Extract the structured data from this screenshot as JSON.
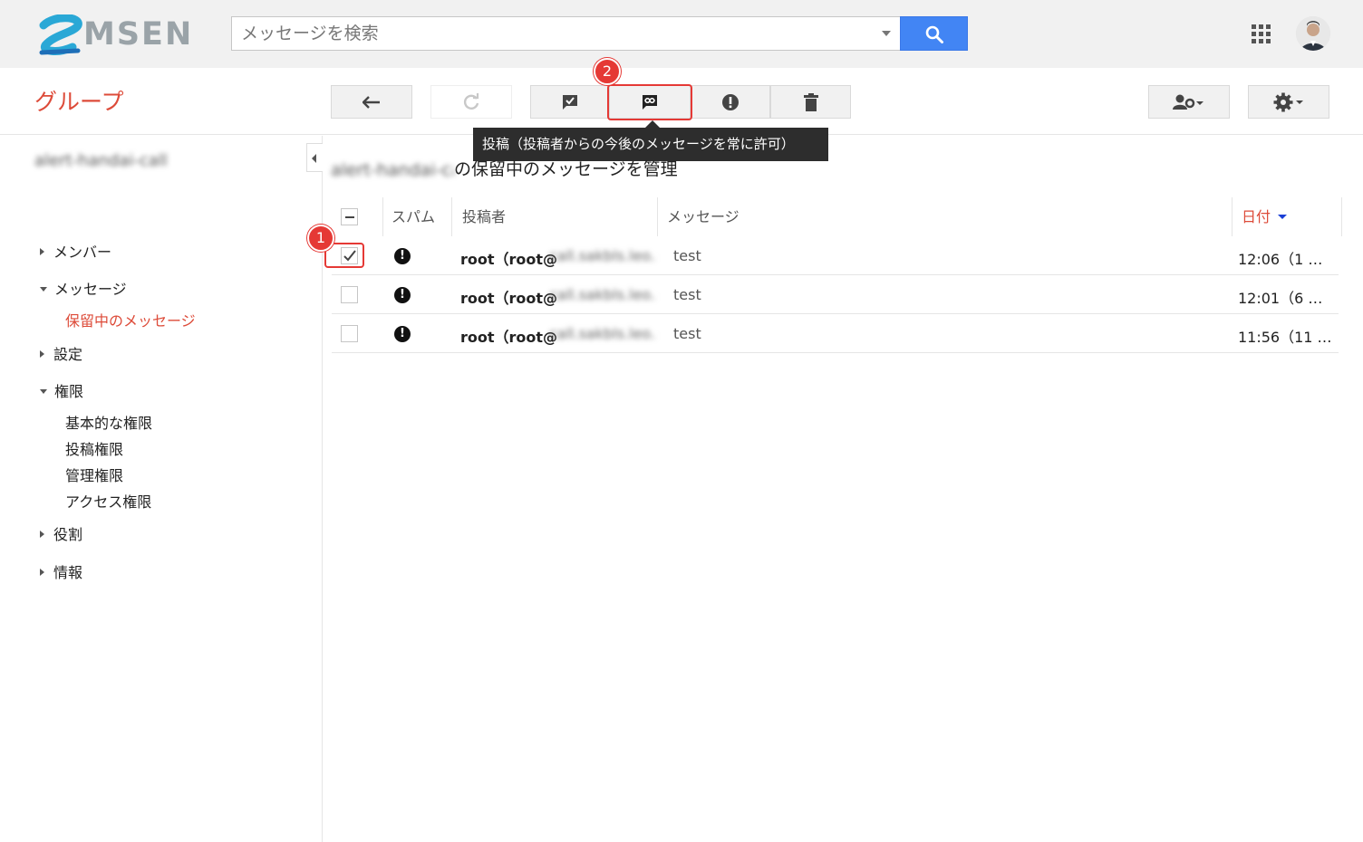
{
  "brand": {
    "name": "MSEN"
  },
  "search": {
    "placeholder": "メッセージを検索"
  },
  "header": {
    "group_title": "グループ"
  },
  "toolbar": {
    "tooltip": "投稿（投稿者からの今後のメッセージを常に許可）"
  },
  "annotations": {
    "badge1": "1",
    "badge2": "2"
  },
  "sidebar": {
    "group_name": "alert-handai-call",
    "items": [
      {
        "label": "メンバー"
      },
      {
        "label": "メッセージ"
      },
      {
        "label": "保留中のメッセージ"
      },
      {
        "label": "設定"
      },
      {
        "label": "権限"
      },
      {
        "label": "基本的な権限"
      },
      {
        "label": "投稿権限"
      },
      {
        "label": "管理権限"
      },
      {
        "label": "アクセス権限"
      },
      {
        "label": "役割"
      },
      {
        "label": "情報"
      }
    ]
  },
  "main": {
    "title_prefix": "alert-handai-call",
    "title_suffix": "の保留中のメッセージを管理",
    "columns": {
      "spam": "スパム",
      "sender": "投稿者",
      "message": "メッセージ",
      "date": "日付"
    },
    "rows": [
      {
        "sender": "root（root@",
        "sender_hidden": "call.sakbls.leo.s",
        "message": "test",
        "date": "12:06（1 …"
      },
      {
        "sender": "root（root@",
        "sender_hidden": "call.sakbls.leo.s",
        "message": "test",
        "date": "12:01（6 …"
      },
      {
        "sender": "root（root@",
        "sender_hidden": "call.sakbls.leo.s",
        "message": "test",
        "date": "11:56（11 …"
      }
    ],
    "spam_mark": "!"
  },
  "colors": {
    "accent": "#dd4b39",
    "search_button": "#4285f4",
    "annotation": "#e53935"
  }
}
